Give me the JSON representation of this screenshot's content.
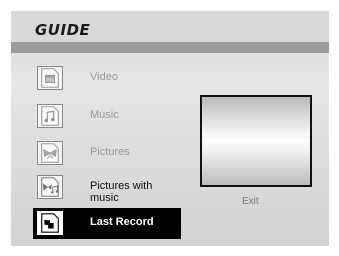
{
  "header": {
    "title": "GUIDE"
  },
  "menu": {
    "items": [
      {
        "label": "Video",
        "icon": "video-file-icon",
        "state": "disabled"
      },
      {
        "label": "Music",
        "icon": "music-file-icon",
        "state": "disabled"
      },
      {
        "label": "Pictures",
        "icon": "pictures-file-icon",
        "state": "disabled"
      },
      {
        "label": "Pictures with music",
        "icon": "pictures-music-file-icon",
        "state": "enabled"
      },
      {
        "label": "Last Record",
        "icon": "last-record-icon",
        "state": "selected"
      }
    ]
  },
  "preview": {
    "exit_label": "Exit"
  }
}
